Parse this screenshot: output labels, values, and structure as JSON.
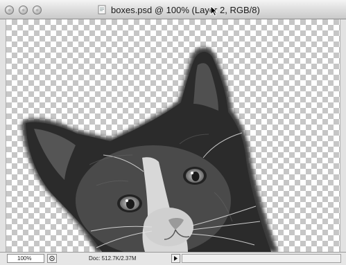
{
  "window": {
    "title": "boxes.psd @ 100% (Layer 2, RGB/8)",
    "controls": [
      "close",
      "minimize",
      "zoom"
    ]
  },
  "canvas": {
    "background": "transparency-checkerboard",
    "content": "kitten-photo"
  },
  "statusbar": {
    "zoom": "100%",
    "doc_info": "Doc: 512.7K/2.37M"
  },
  "colors": {
    "checker_light": "#ffffff",
    "checker_dark": "#c6c6c6",
    "titlebar": "#dcdcdc"
  }
}
